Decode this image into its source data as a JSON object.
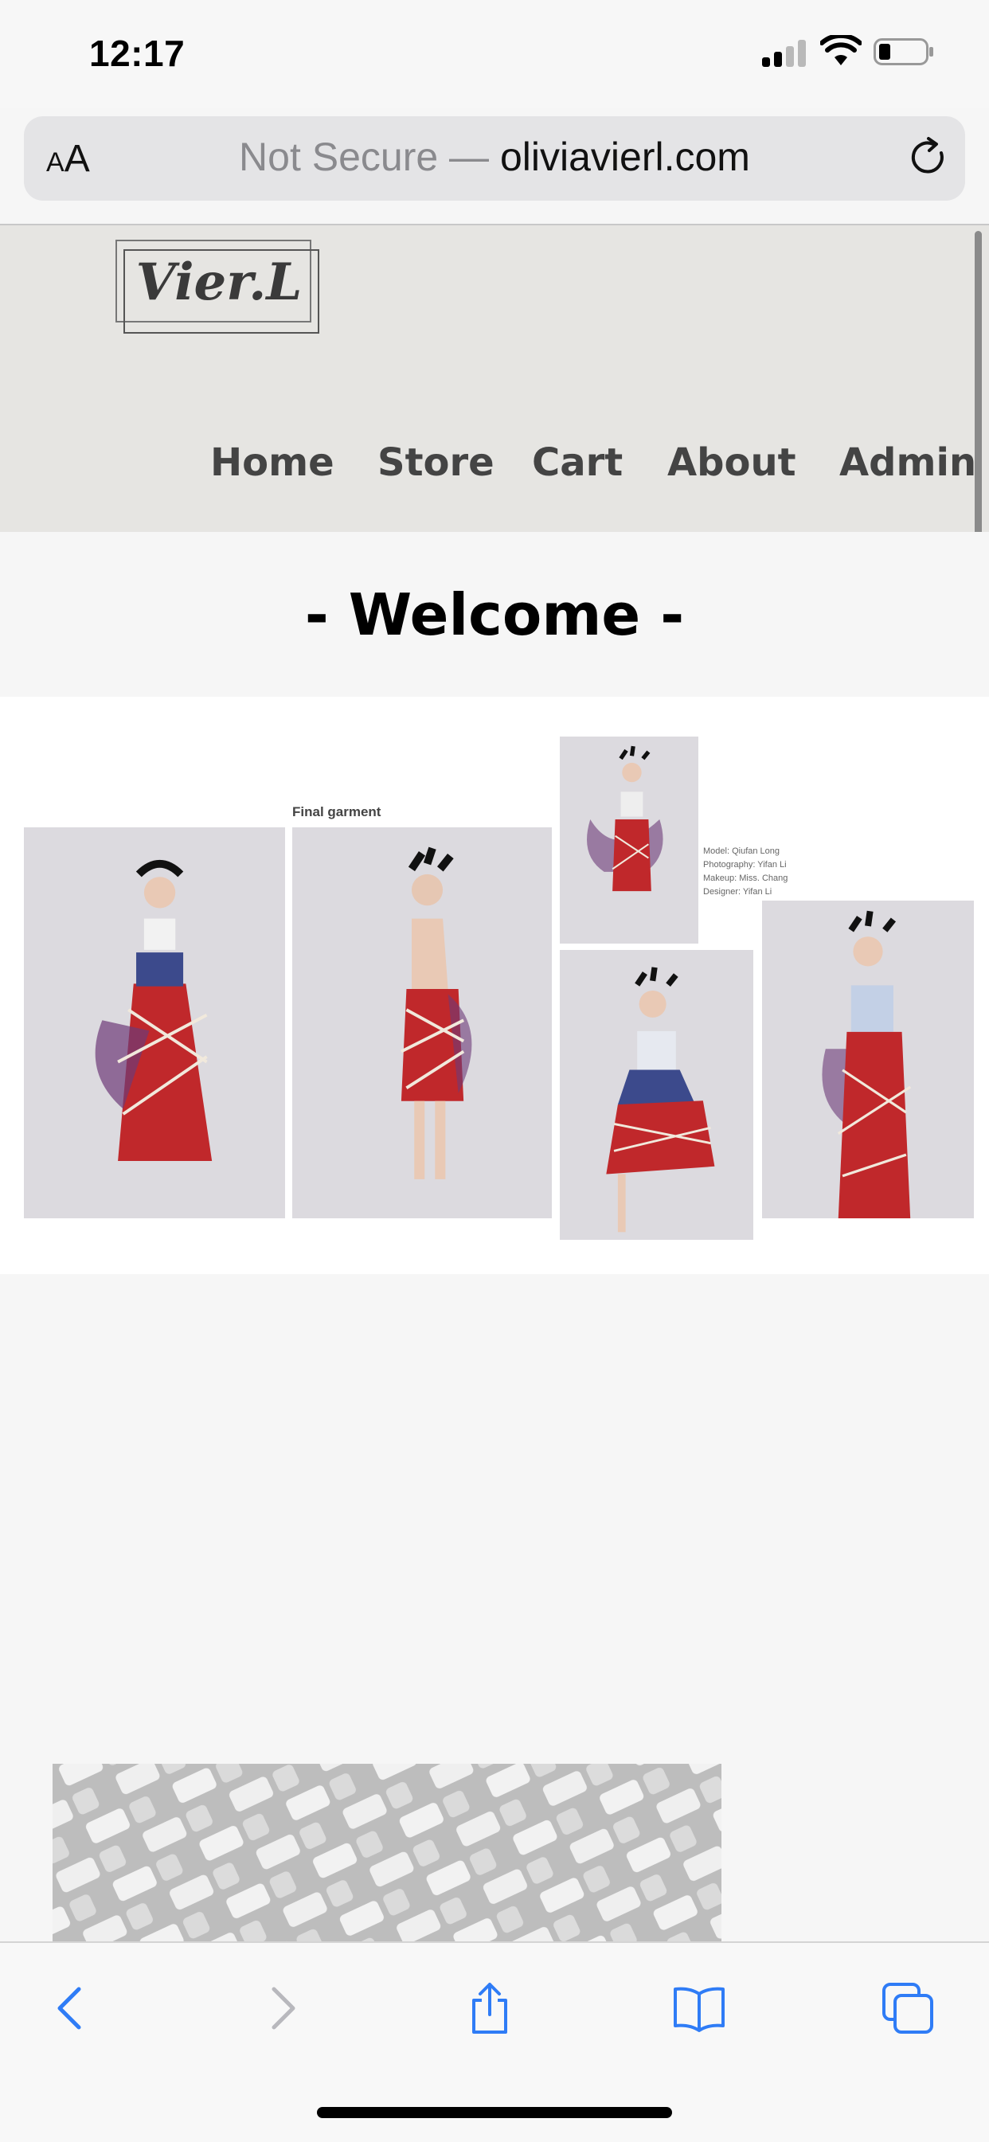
{
  "status": {
    "time": "12:17"
  },
  "browser": {
    "text_size_button": {
      "small": "A",
      "large": "A"
    },
    "url_security": "Not Secure —",
    "url_domain": "oliviavierl.com"
  },
  "site": {
    "logo": "Vier.L",
    "nav": [
      "Home",
      "Store",
      "Cart",
      "About",
      "Admin"
    ],
    "welcome": "- Welcome -"
  },
  "gallery": {
    "caption": "Final garment",
    "credits": [
      "Model: Qiufan Long",
      "Photography: Yifan Li",
      "Makeup: Miss. Chang",
      "Designer: Yifan Li"
    ]
  },
  "toolbar_icons": [
    "back-icon",
    "forward-icon",
    "share-icon",
    "bookmarks-icon",
    "tabs-icon"
  ],
  "colors": {
    "accent": "#2f7cf6",
    "header_bg": "#e6e5e2",
    "nav_text": "#444444",
    "dress_red": "#c0282b"
  }
}
